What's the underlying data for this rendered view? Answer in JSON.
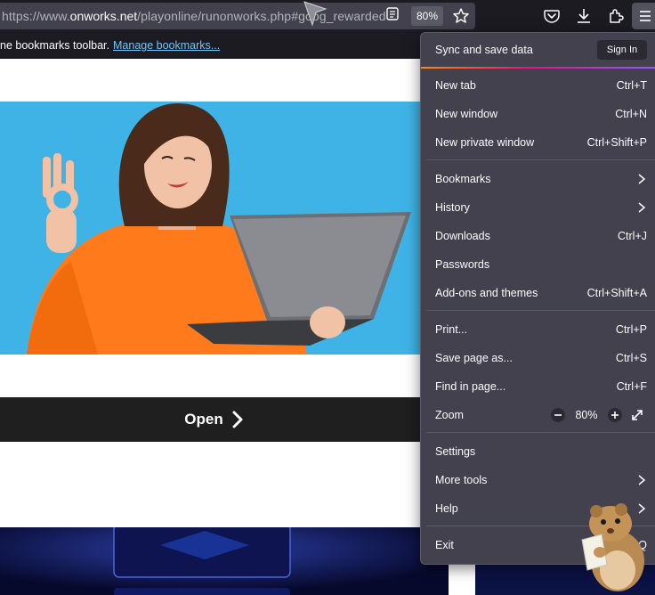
{
  "urlbar": {
    "url_prefix": "https://www.",
    "url_domain": "onworks.net",
    "url_path": "/playonline/runonworks.php#goog_rewarded",
    "zoom_badge": "80%"
  },
  "bookmarks_bar": {
    "hint_text": "ne bookmarks toolbar.",
    "manage_link": "Manage bookmarks..."
  },
  "page": {
    "open_button": "Open"
  },
  "app_menu": {
    "sync_label": "Sync and save data",
    "sign_in": "Sign In",
    "items": [
      {
        "label": "New tab",
        "shortcut": "Ctrl+T"
      },
      {
        "label": "New window",
        "shortcut": "Ctrl+N"
      },
      {
        "label": "New private window",
        "shortcut": "Ctrl+Shift+P"
      },
      {
        "label": "Bookmarks",
        "shortcut": ""
      },
      {
        "label": "History",
        "shortcut": ""
      },
      {
        "label": "Downloads",
        "shortcut": "Ctrl+J"
      },
      {
        "label": "Passwords",
        "shortcut": ""
      },
      {
        "label": "Add-ons and themes",
        "shortcut": "Ctrl+Shift+A"
      },
      {
        "label": "Print...",
        "shortcut": "Ctrl+P"
      },
      {
        "label": "Save page as...",
        "shortcut": "Ctrl+S"
      },
      {
        "label": "Find in page...",
        "shortcut": "Ctrl+F"
      },
      {
        "label": "Zoom",
        "shortcut": ""
      },
      {
        "label": "Settings",
        "shortcut": ""
      },
      {
        "label": "More tools",
        "shortcut": ""
      },
      {
        "label": "Help",
        "shortcut": ""
      },
      {
        "label": "Exit",
        "shortcut": "Q"
      }
    ],
    "zoom_value": "80%"
  },
  "colors": {
    "toolbar": "#1c1b22",
    "menu_bg": "#42414d",
    "link": "#6fc6f9",
    "hero_bg": "#3fb3e6",
    "sweater": "#ff7a1a"
  },
  "icons": [
    "reader-view-icon",
    "bookmark-star-icon",
    "pocket-icon",
    "downloads-icon",
    "extensions-icon",
    "hamburger-menu-icon",
    "chevron-right-icon",
    "zoom-out-icon",
    "zoom-in-icon",
    "fullscreen-icon"
  ]
}
